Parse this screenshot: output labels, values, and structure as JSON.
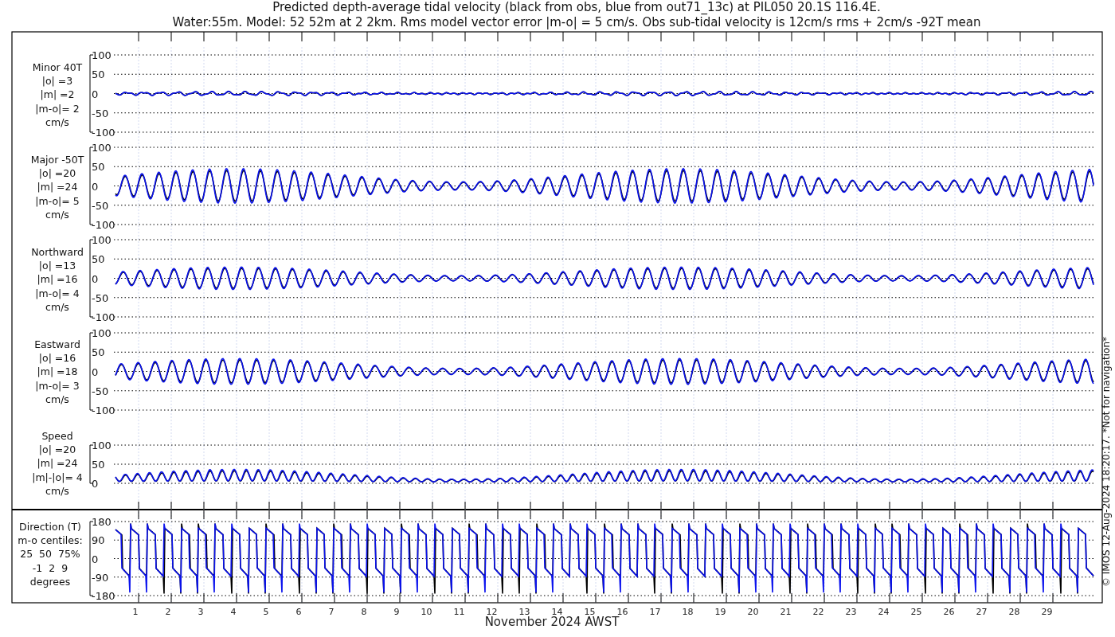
{
  "title": [
    "Predicted depth-average tidal velocity (black from obs, blue from out71_13c) at PIL050 20.1S 116.4E.",
    "Water:55m. Model: 52 52m at 2 2km. Rms model vector error |m-o| = 5 cm/s. Obs sub-tidal velocity is 12cm/s rms + 2cm/s -92T mean"
  ],
  "panels": [
    {
      "kind": "velocity",
      "label": [
        "Minor 40T",
        "|o| =3",
        "|m| =2",
        "|m-o|= 2",
        "cm/s"
      ],
      "yticks": [
        "100",
        "50",
        "0",
        "-50",
        "-100"
      ]
    },
    {
      "kind": "velocity",
      "label": [
        "Major -50T",
        "|o| =20",
        "|m| =24",
        "|m-o|= 5",
        "cm/s"
      ],
      "yticks": [
        "100",
        "50",
        "0",
        "-50",
        "-100"
      ]
    },
    {
      "kind": "velocity",
      "label": [
        "Northward",
        "|o| =13",
        "|m| =16",
        "|m-o|= 4",
        "cm/s"
      ],
      "yticks": [
        "100",
        "50",
        "0",
        "-50",
        "-100"
      ]
    },
    {
      "kind": "velocity",
      "label": [
        "Eastward",
        "|o| =16",
        "|m| =18",
        "|m-o|= 3",
        "cm/s"
      ],
      "yticks": [
        "100",
        "50",
        "0",
        "-50",
        "-100"
      ]
    },
    {
      "kind": "speed",
      "label": [
        "Speed",
        "|o| =20",
        "|m| =24",
        "|m|-|o|= 4",
        "cm/s"
      ],
      "yticks": [
        "100",
        "50",
        "0"
      ]
    },
    {
      "kind": "direction",
      "label": [
        "Direction (T)",
        "m-o centiles:",
        "25  50  75%",
        "-1  2  9",
        "degrees"
      ],
      "yticks": [
        "180",
        "90",
        "0",
        "-90",
        "-180"
      ]
    }
  ],
  "xticks": [
    "1",
    "2",
    "3",
    "4",
    "5",
    "6",
    "7",
    "8",
    "9",
    "10",
    "11",
    "12",
    "13",
    "14",
    "15",
    "16",
    "17",
    "18",
    "19",
    "20",
    "21",
    "22",
    "23",
    "24",
    "25",
    "26",
    "27",
    "28",
    "29"
  ],
  "xlabel": "November 2024 AWST",
  "credit": "© IMOS 12-Aug-2024 18:20:17. *Not for navigation*"
}
